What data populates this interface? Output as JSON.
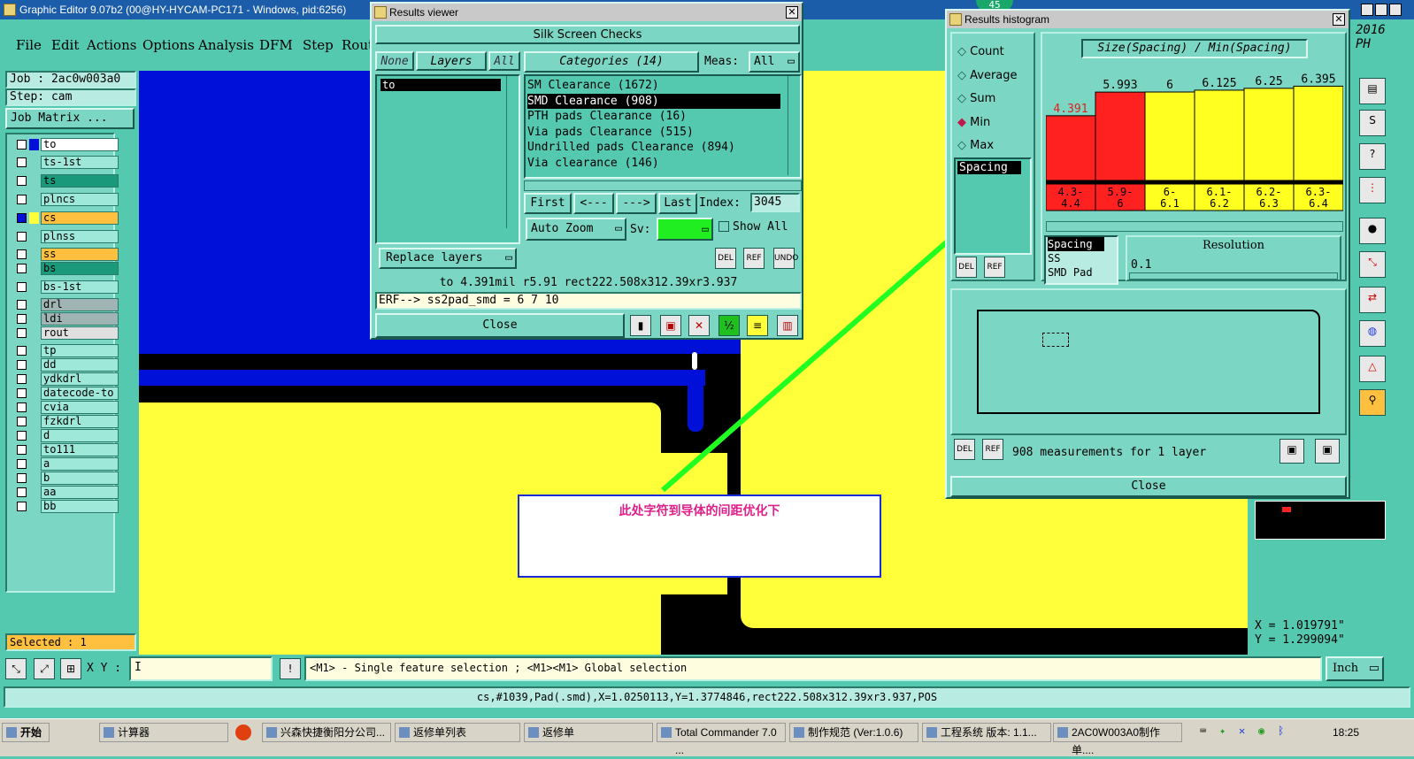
{
  "app": {
    "title": "Graphic Editor 9.07b2 (00@HY-HYCAM-PC171 - Windows, pid:6256)"
  },
  "menu": [
    "File",
    "Edit",
    "Actions",
    "Options",
    "Analysis",
    "DFM",
    "Step",
    "Rout"
  ],
  "left": {
    "job": "Job : 2ac0w003a0",
    "step": "Step: cam",
    "job_matrix": "Job Matrix ...",
    "selected": "Selected : 1",
    "layers": [
      "to",
      "ts-1st",
      "ts",
      "plncs",
      "cs",
      "plnss",
      "ss",
      "bs",
      "bs-1st",
      "drl",
      "ldi",
      "rout",
      "tp",
      "dd",
      "ydkdrl",
      "datecode-to",
      "cvia",
      "fzkdrl",
      "d",
      "to111",
      "a",
      "b",
      "aa",
      "bb"
    ]
  },
  "results_viewer": {
    "title": "Results viewer",
    "header": "Silk Screen Checks",
    "none": "None",
    "layers": "Layers",
    "all": "All",
    "categories": "Categories (14)",
    "meas_label": "Meas:",
    "meas_value": "All",
    "layer_list": [
      "to"
    ],
    "category_list": [
      "SM Clearance (1672)",
      "SMD Clearance (908)",
      "PTH pads Clearance (16)",
      "Via pads Clearance (515)",
      "Undrilled pads Clearance (894)",
      "Via clearance (146)"
    ],
    "first": "First",
    "prev": "<---",
    "next": "--->",
    "last": "Last",
    "index_label": "Index:",
    "index_value": "3045",
    "auto_zoom": "Auto Zoom",
    "sv_label": "Sv:",
    "show_all": "Show All",
    "replace_layers": "Replace layers",
    "del": "DEL",
    "ref": "REF",
    "undo": "UNDO",
    "info": "to 4.391mil  r5.91  rect222.508x312.39xr3.937",
    "erf": "ERF--> ss2pad_smd = 6 7 10",
    "close": "Close"
  },
  "histogram": {
    "title": "Results histogram",
    "badge": "45",
    "modes": [
      "Count",
      "Average",
      "Sum",
      "Min",
      "Max"
    ],
    "selected_mode": "Min",
    "spacing_label": "Spacing",
    "chart_title": "Size(Spacing) / Min(Spacing)",
    "resolution_label": "Resolution",
    "resolution_value": "0.1",
    "types": [
      "Spacing",
      "SS",
      "SMD Pad"
    ],
    "measurements": "908 measurements for 1 layer",
    "close": "Close",
    "del": "DEL",
    "ref": "REF"
  },
  "chart_data": {
    "type": "bar",
    "title": "Size(Spacing) / Min(Spacing)",
    "categories": [
      "4.3-4.4",
      "5.9-6",
      "6-6.1",
      "6.1-6.2",
      "6.2-6.3",
      "6.3-6.4"
    ],
    "values": [
      4.391,
      5.993,
      6,
      6.125,
      6.25,
      6.395
    ],
    "value_labels": [
      "4.391",
      "5.993",
      "6",
      "6.125",
      "6.25",
      "6.395"
    ],
    "colors": [
      "#ff2020",
      "#ff2020",
      "#ffff20",
      "#ffff20",
      "#ffff20",
      "#ffff20"
    ]
  },
  "annotation": {
    "text": "此处字符到导体的间距优化下"
  },
  "right": {
    "year": "2016",
    "code": "PH",
    "x": "X = 1.019791\"",
    "y": "Y = 1.299094\""
  },
  "bottom": {
    "xy_label": "X Y :",
    "xy_value": "I",
    "hint": "<M1> - Single feature selection ; <M1><M1> Global selection",
    "unit": "Inch",
    "status": "cs,#1039,Pad(.smd),X=1.0250113,Y=1.3774846,rect222.508x312.39xr3.937,POS"
  },
  "taskbar": {
    "start": "开始",
    "tasks": [
      "计算器",
      "兴森快捷衡阳分公司...",
      "返修单列表",
      "返修单",
      "Total Commander 7.0 ...",
      "制作规范 (Ver:1.0.6)",
      "工程系统  版本: 1.1...",
      "2AC0W003A0制作单...."
    ],
    "clock": "18:25"
  }
}
